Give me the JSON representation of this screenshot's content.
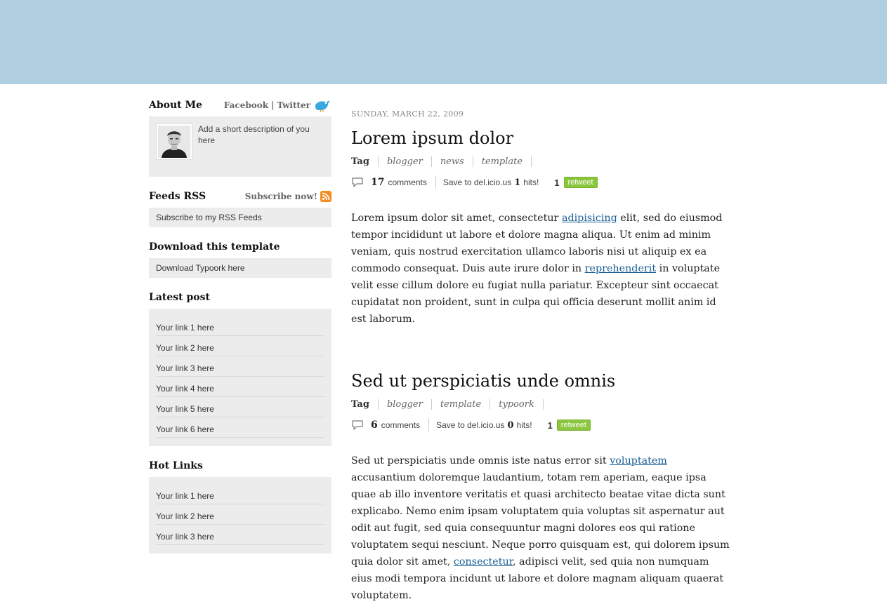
{
  "sidebar": {
    "about": {
      "title": "About Me",
      "facebook": "Facebook",
      "divider": "|",
      "twitter": "Twitter",
      "description": "Add a short description of you here"
    },
    "feeds": {
      "title": "Feeds RSS",
      "subscribe": "Subscribe now!",
      "link": "Subscribe to my RSS Feeds"
    },
    "download": {
      "title": "Download this template",
      "link": "Download Typoork here"
    },
    "latest": {
      "title": "Latest post",
      "items": [
        "Your link 1 here",
        "Your link 2 here",
        "Your link 3 here",
        "Your link 4 here",
        "Your link 5 here",
        "Your link 6 here"
      ]
    },
    "hot": {
      "title": "Hot Links",
      "items": [
        "Your link 1 here",
        "Your link 2 here",
        "Your link 3 here"
      ]
    }
  },
  "posts": [
    {
      "date": "SUNDAY, MARCH 22, 2009",
      "title": "Lorem ipsum dolor",
      "tag_label": "Tag",
      "tags": [
        "blogger",
        "news",
        "template"
      ],
      "comments_count": "17",
      "comments_label": "comments",
      "save_label": "Save to del.icio.us",
      "hits_count": "1",
      "hits_label": "hits!",
      "retweet_count": "1",
      "retweet_label": "retweet",
      "body": {
        "p1": "Lorem ipsum dolor sit amet, consectetur ",
        "link1": "adipisicing",
        "p2": " elit, sed do eiusmod tempor incididunt ut labore et dolore magna aliqua. Ut enim ad minim veniam, quis nostrud exercitation ullamco laboris nisi ut aliquip ex ea commodo consequat. Duis aute irure dolor in ",
        "link2": "reprehenderit",
        "p3": " in voluptate velit esse cillum dolore eu fugiat nulla pariatur. Excepteur sint occaecat cupidatat non proident, sunt in culpa qui officia deserunt mollit anim id est laborum."
      }
    },
    {
      "title": "Sed ut perspiciatis unde omnis",
      "tag_label": "Tag",
      "tags": [
        "blogger",
        "template",
        "typoork"
      ],
      "comments_count": "6",
      "comments_label": "comments",
      "save_label": "Save to del.icio.us",
      "hits_count": "0",
      "hits_label": "hits!",
      "retweet_count": "1",
      "retweet_label": "retweet",
      "body": {
        "p1": "Sed ut perspiciatis unde omnis iste natus error sit ",
        "link1": "voluptatem",
        "p2": " accusantium doloremque laudantium, totam rem aperiam, eaque ipsa quae ab illo inventore veritatis et quasi architecto beatae vitae dicta sunt explicabo. Nemo enim ipsam voluptatem quia voluptas sit aspernatur aut odit aut fugit, sed quia consequuntur magni dolores eos qui ratione voluptatem sequi nesciunt. Neque porro quisquam est, qui dolorem ipsum quia dolor sit amet, ",
        "link2": "consectetur",
        "p3": ", adipisci velit, sed quia non numquam eius modi tempora incidunt ut labore et dolore magnam aliquam quaerat voluptatem."
      }
    }
  ],
  "colors": {
    "header": "#b0cfe0",
    "box": "#ececec",
    "link": "#1a5f95",
    "retweet": "#8cc63f"
  }
}
